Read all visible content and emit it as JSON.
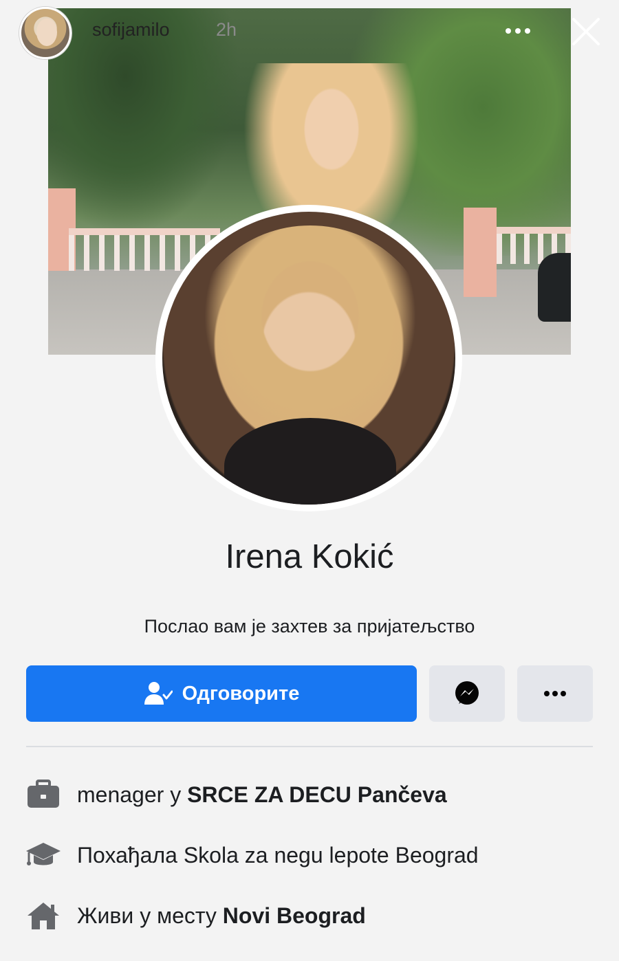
{
  "story": {
    "username": "sofijamilo",
    "time": "2h",
    "avatar_icon": "user-avatar",
    "more_icon": "more-horizontal-icon",
    "close_icon": "close-icon"
  },
  "profile": {
    "name": "Irena Kokić",
    "subtitle": "Послао вам је захтев за пријатељство"
  },
  "actions": {
    "respond_label": "Одговорите",
    "respond_icon": "person-check-icon",
    "messenger_icon": "messenger-icon",
    "more_icon": "more-horizontal-icon",
    "primary_color": "#1877f2",
    "secondary_color": "#e4e6eb"
  },
  "info": {
    "work": {
      "prefix": "menager у ",
      "bold": "SRCE ZA DECU Pančeva",
      "icon": "briefcase-icon"
    },
    "education": {
      "prefix": "Похађала Skola za negu lepote Beograd",
      "icon": "graduation-cap-icon"
    },
    "home": {
      "prefix": "Живи у месту ",
      "bold": "Novi Beograd",
      "icon": "house-icon"
    }
  }
}
